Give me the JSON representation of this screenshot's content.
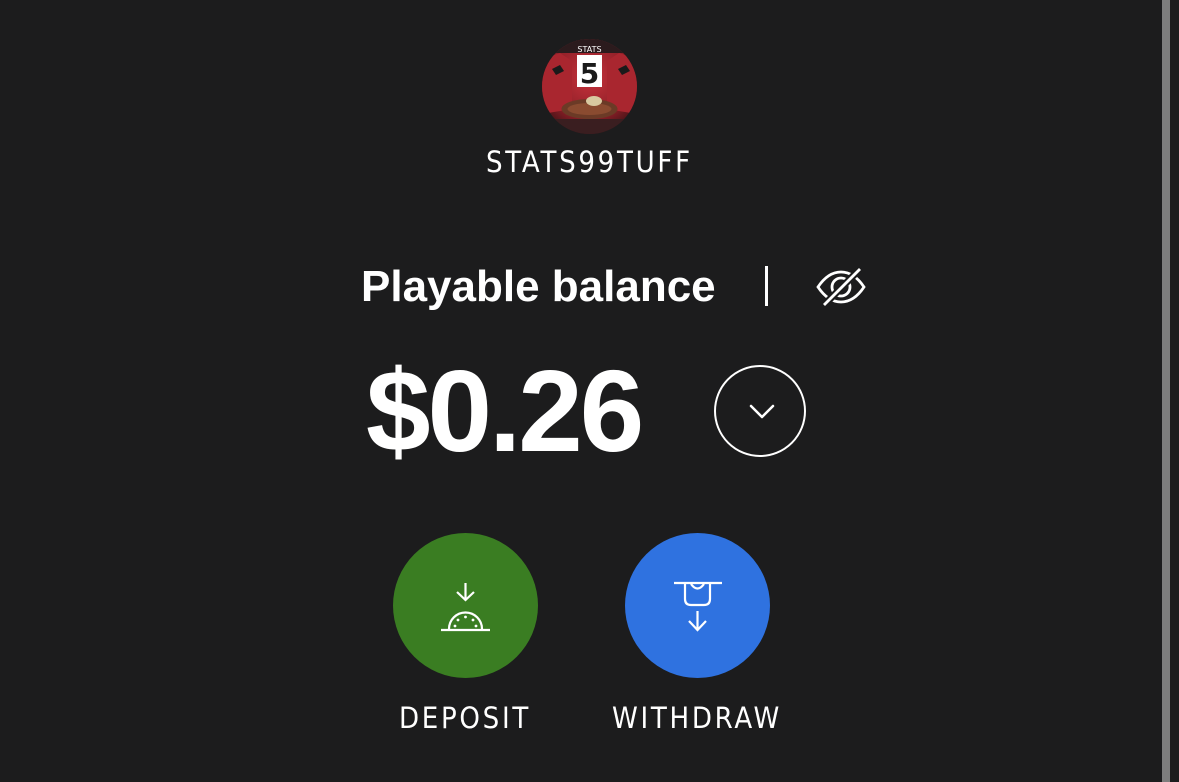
{
  "profile": {
    "username": "STATS99TUFF",
    "avatar_icon": "jersey-avatar-icon",
    "jersey_name": "STATS",
    "jersey_number": "5"
  },
  "balance": {
    "label": "Playable balance",
    "amount": "$0.26",
    "visibility_icon": "eye-slash-icon",
    "expand_icon": "chevron-down-icon"
  },
  "actions": {
    "deposit": {
      "label": "DEPOSIT",
      "icon": "deposit-icon",
      "color": "#3a7d22"
    },
    "withdraw": {
      "label": "WITHDRAW",
      "icon": "withdraw-icon",
      "color": "#2f72e0"
    }
  },
  "theme": {
    "background": "#1c1c1d",
    "text": "#ffffff"
  }
}
